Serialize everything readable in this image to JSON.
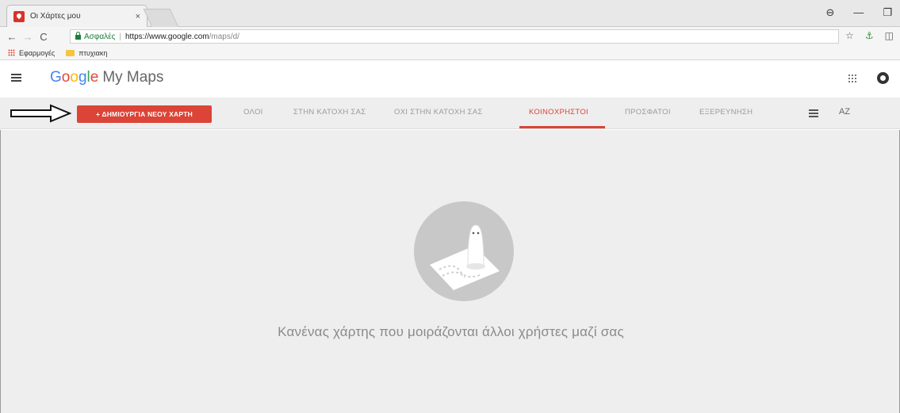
{
  "browser": {
    "tab_title": "Οι Χάρτες μου",
    "tab_close": "×",
    "window_controls": [
      "⊖",
      "—",
      "❐"
    ],
    "nav": {
      "back": "←",
      "forward": "→",
      "reload": "C"
    },
    "security_label": "Ασφαλές",
    "url_host": "https://www.google.com",
    "url_path": "/maps/d/",
    "toolbar_icons": {
      "star": "☆",
      "extension": "⚓",
      "camera": "◫"
    },
    "bookmarks": {
      "apps_label": "Εφαρμογές",
      "folder_label": "πτυχιακη"
    }
  },
  "app": {
    "brand_letters": [
      "G",
      "o",
      "o",
      "g",
      "l",
      "e"
    ],
    "product": "My Maps"
  },
  "toolbar": {
    "create_button": "+ ΔΗΜΙΟΥΡΓΙΑ ΝΕΟΥ ΧΑΡΤΗ",
    "tabs": [
      {
        "label": "ΟΛΟΙ",
        "active": false
      },
      {
        "label": "ΣΤΗΝ ΚΑΤΟΧΗ ΣΑΣ",
        "active": false
      },
      {
        "label": "ΟΧΙ ΣΤΗΝ ΚΑΤΟΧΗ ΣΑΣ",
        "active": false
      },
      {
        "label": "ΚΟΙΝΟΧΡΗΣΤΟΙ",
        "active": true
      },
      {
        "label": "ΠΡΟΣΦΑΤΟΙ",
        "active": false
      },
      {
        "label": "ΕΞΕΡΕΥΝΗΣΗ",
        "active": false
      }
    ],
    "sort_label": "AZ",
    "accent_color": "#db4437"
  },
  "main": {
    "empty_message": "Κανένας χάρτης που μοιράζονται άλλοι χρήστες μαζί σας"
  }
}
